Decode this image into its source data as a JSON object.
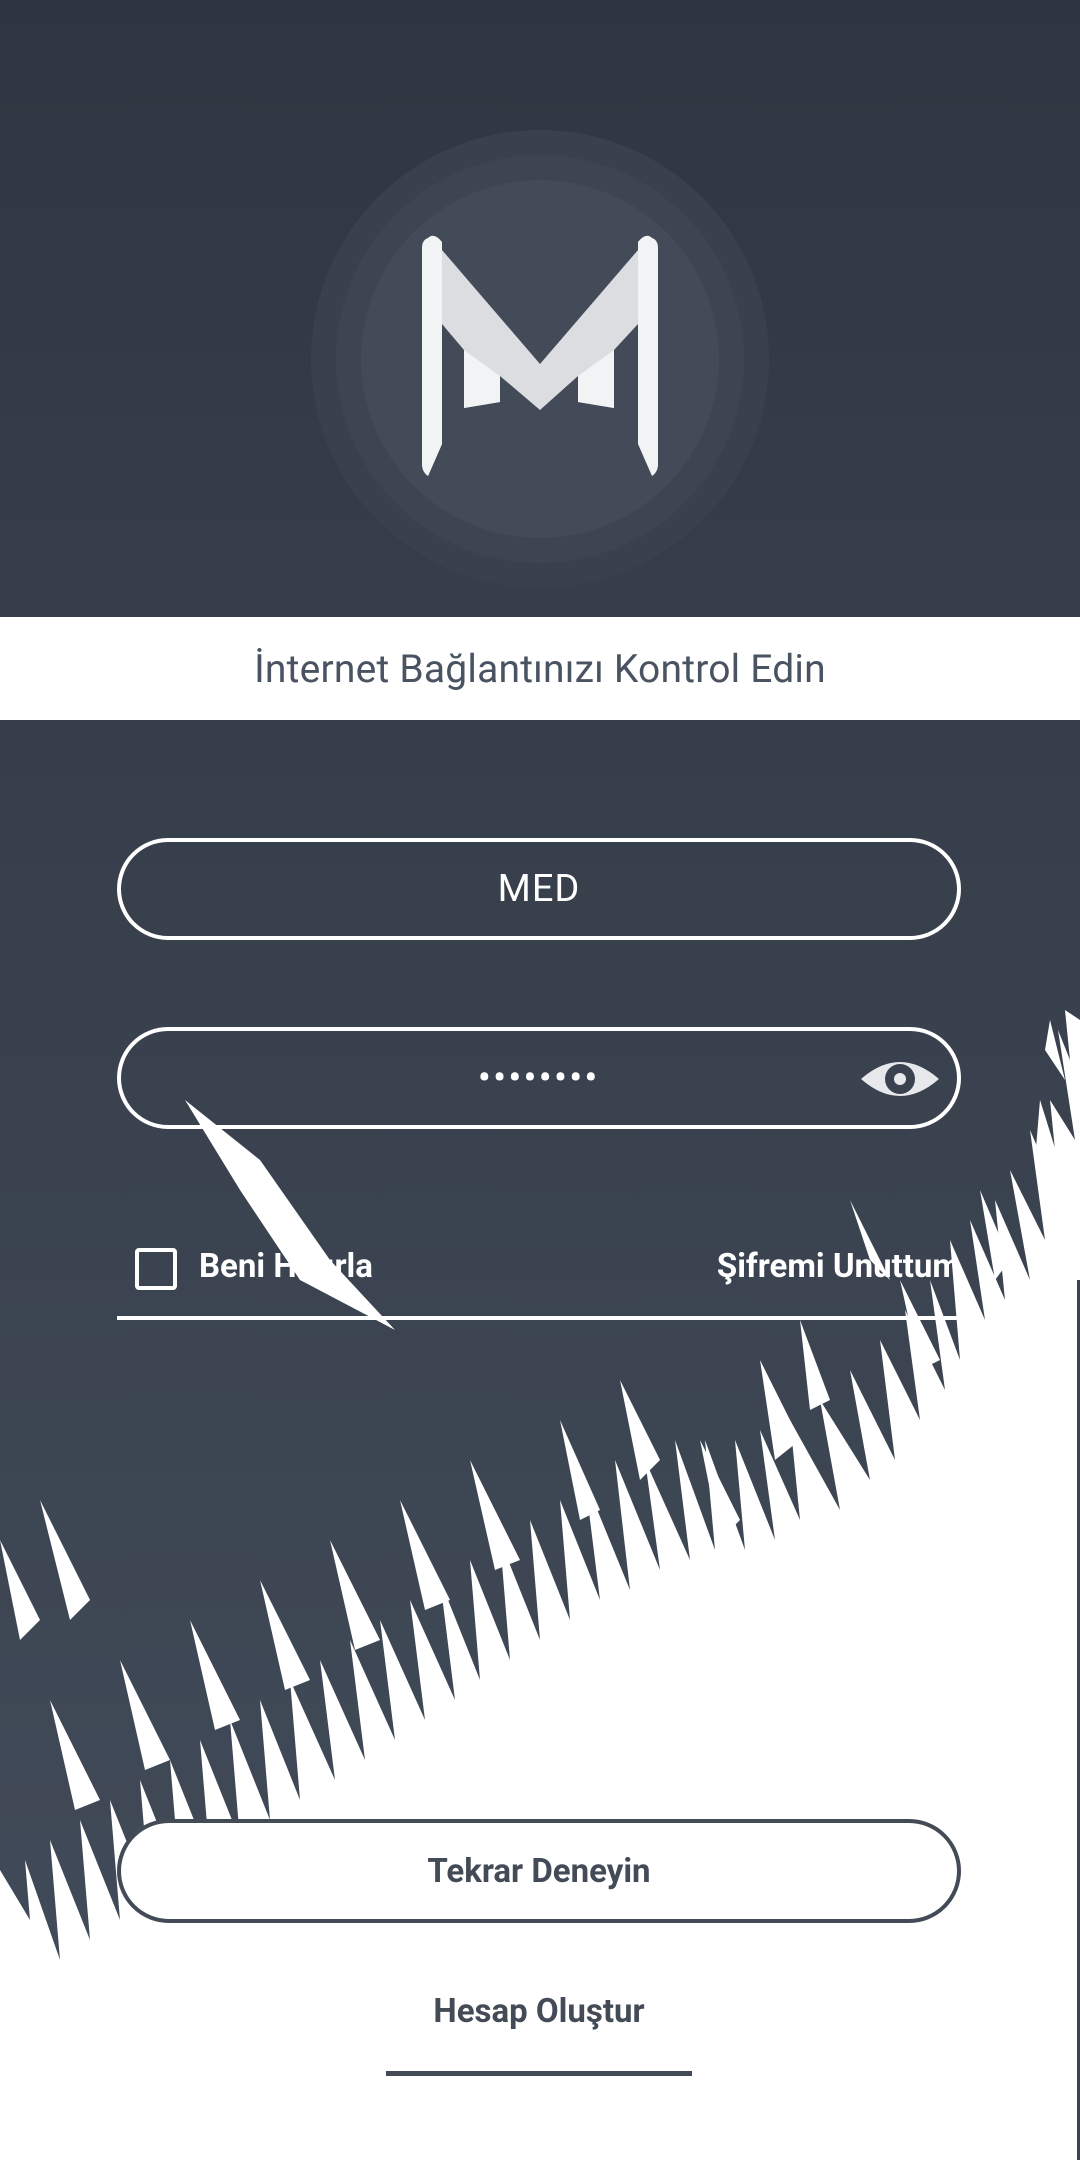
{
  "notice": {
    "text": "İnternet Bağlantınızı Kontrol Edin"
  },
  "login": {
    "username_value": "MED",
    "password_value": "••••••••",
    "remember_label": "Beni Hatırla",
    "remember_checked": false,
    "forgot_label": "Şifremi Unuttum"
  },
  "actions": {
    "retry_label": "Tekrar Deneyin",
    "create_account_label": "Hesap Oluştur"
  },
  "colors": {
    "dark_bg": "#3a424f",
    "header_bg": "#2f3641",
    "text_dark": "#434b57",
    "white": "#ffffff"
  },
  "icons": {
    "logo": "m-logo-icon",
    "password_toggle": "eye-icon",
    "remember": "checkbox-icon"
  }
}
